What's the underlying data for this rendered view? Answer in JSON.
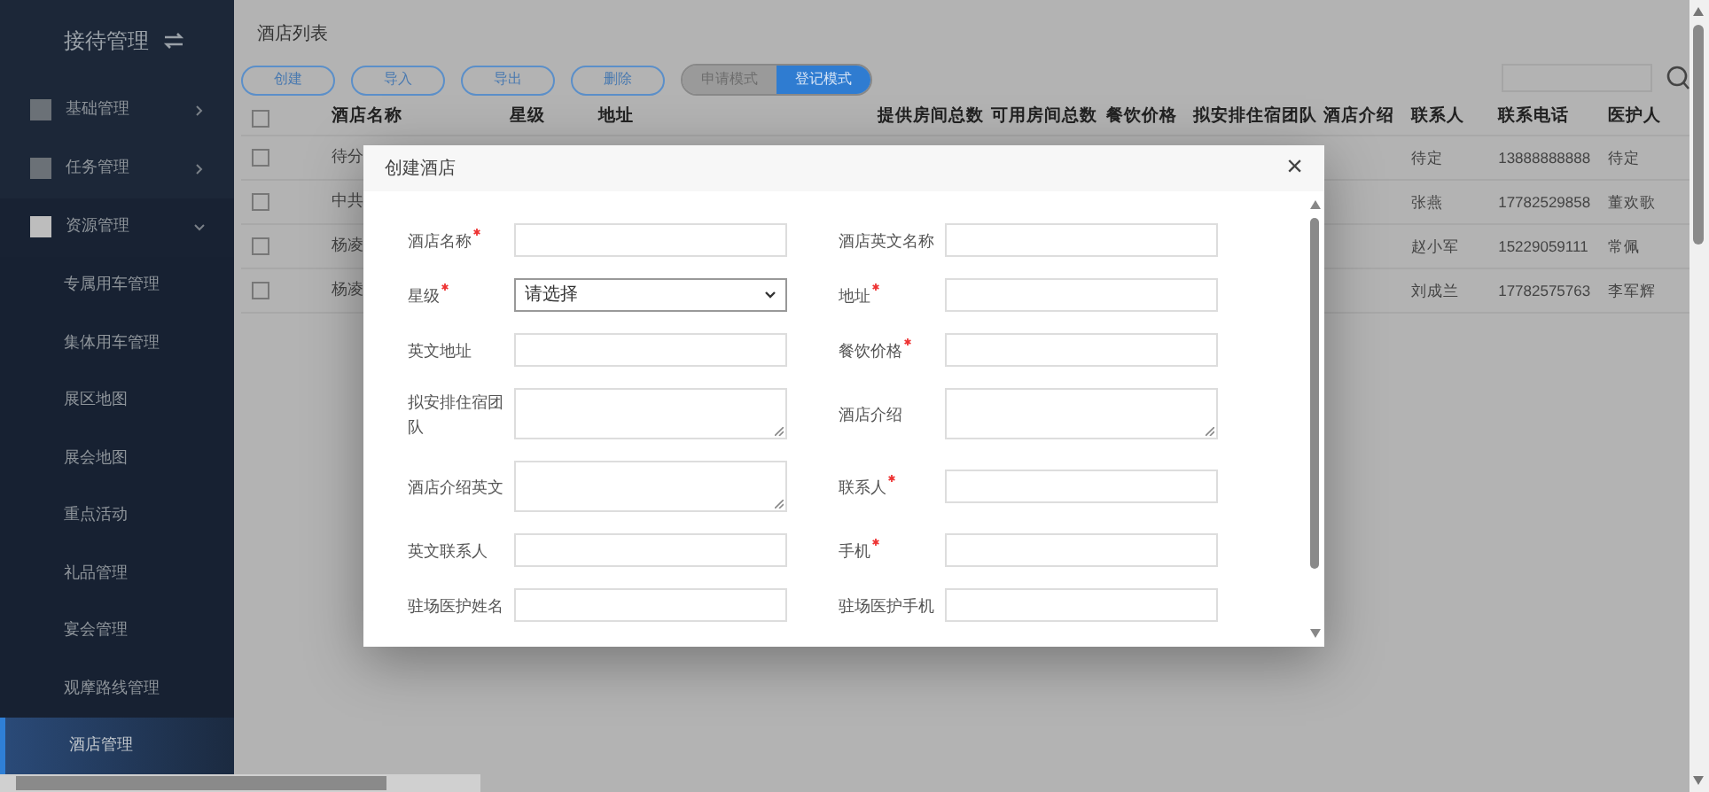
{
  "sidebar": {
    "title": "接待管理",
    "items": [
      {
        "label": "基础管理",
        "expanded": false
      },
      {
        "label": "任务管理",
        "expanded": false
      },
      {
        "label": "资源管理",
        "expanded": true,
        "children": [
          {
            "label": "专属用车管理",
            "selected": false
          },
          {
            "label": "集体用车管理",
            "selected": false
          },
          {
            "label": "展区地图",
            "selected": false
          },
          {
            "label": "展会地图",
            "selected": false
          },
          {
            "label": "重点活动",
            "selected": false
          },
          {
            "label": "礼品管理",
            "selected": false
          },
          {
            "label": "宴会管理",
            "selected": false
          },
          {
            "label": "观摩路线管理",
            "selected": false
          },
          {
            "label": "酒店管理",
            "selected": true
          }
        ]
      }
    ]
  },
  "page_title": "酒店列表",
  "toolbar": {
    "buttons": [
      "创建",
      "导入",
      "导出",
      "删除"
    ],
    "modes": [
      {
        "label": "申请模式",
        "selected": false
      },
      {
        "label": "登记模式",
        "selected": true
      }
    ]
  },
  "table": {
    "select_all": {
      "checked": false
    },
    "columns": [
      "酒店名称",
      "星级",
      "地址",
      "提供房间总数",
      "可用房间总数",
      "餐饮价格",
      "拟安排住宿团队",
      "酒店介绍",
      "联系人",
      "联系电话",
      "医护人"
    ],
    "rows": [
      {
        "checked": false,
        "name": "待分",
        "contact": "待定",
        "phone": "13888888888",
        "medic": "待定"
      },
      {
        "checked": false,
        "name": "中共",
        "contact": "张燕",
        "phone": "17782529858",
        "medic": "董欢歌"
      },
      {
        "checked": false,
        "name": "杨凌",
        "contact": "赵小军",
        "phone": "15229059111",
        "medic": "常佩"
      },
      {
        "checked": false,
        "name": "杨凌",
        "contact": "刘成兰",
        "phone": "17782575763",
        "medic": "李军辉"
      }
    ]
  },
  "dialog": {
    "title": "创建酒店",
    "close": "×",
    "fields": [
      {
        "label": "酒店名称",
        "required": true,
        "kind": "input"
      },
      {
        "label": "酒店英文名称",
        "required": false,
        "kind": "input"
      },
      {
        "label": "星级",
        "required": true,
        "kind": "select",
        "value": "请选择"
      },
      {
        "label": "地址",
        "required": true,
        "kind": "input"
      },
      {
        "label": "英文地址",
        "required": false,
        "kind": "input"
      },
      {
        "label": "餐饮价格",
        "required": true,
        "kind": "input"
      },
      {
        "label": "拟安排住宿团队",
        "required": false,
        "kind": "textarea"
      },
      {
        "label": "酒店介绍",
        "required": false,
        "kind": "textarea"
      },
      {
        "label": "酒店介绍英文",
        "required": false,
        "kind": "textarea"
      },
      {
        "label": "联系人",
        "required": true,
        "kind": "input"
      },
      {
        "label": "英文联系人",
        "required": false,
        "kind": "input"
      },
      {
        "label": "手机",
        "required": true,
        "kind": "input"
      },
      {
        "label": "驻场医护姓名",
        "required": false,
        "kind": "input"
      },
      {
        "label": "驻场医护手机",
        "required": false,
        "kind": "input"
      }
    ]
  }
}
